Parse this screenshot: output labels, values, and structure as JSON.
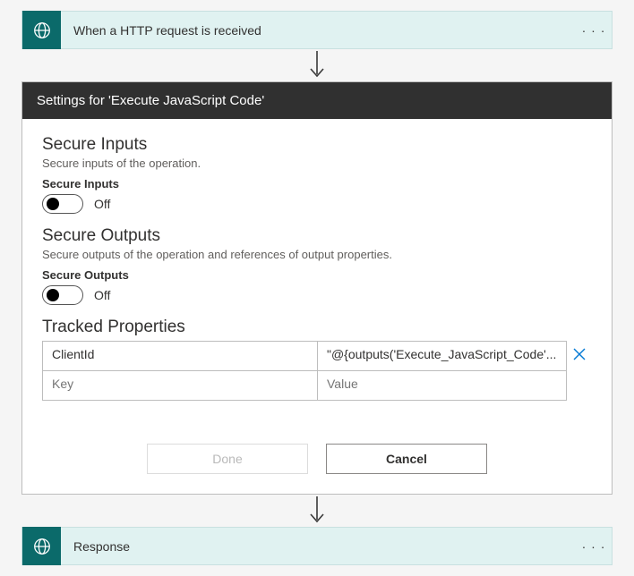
{
  "trigger": {
    "title": "When a HTTP request is received"
  },
  "settings": {
    "panel_title": "Settings for 'Execute JavaScript Code'",
    "secure_inputs": {
      "title": "Secure Inputs",
      "description": "Secure inputs of the operation.",
      "label": "Secure Inputs",
      "state_label": "Off"
    },
    "secure_outputs": {
      "title": "Secure Outputs",
      "description": "Secure outputs of the operation and references of output properties.",
      "label": "Secure Outputs",
      "state_label": "Off"
    },
    "tracked_properties": {
      "title": "Tracked Properties",
      "rows": [
        {
          "key": "ClientId",
          "value": "\"@{outputs('Execute_JavaScript_Code'..."
        }
      ],
      "placeholder": {
        "key": "Key",
        "value": "Value"
      }
    },
    "buttons": {
      "done": "Done",
      "cancel": "Cancel"
    }
  },
  "response": {
    "title": "Response"
  },
  "colors": {
    "teal": "#0b6a6a",
    "header_bg": "#e0f2f1",
    "dark": "#303030",
    "link": "#0078d4"
  }
}
